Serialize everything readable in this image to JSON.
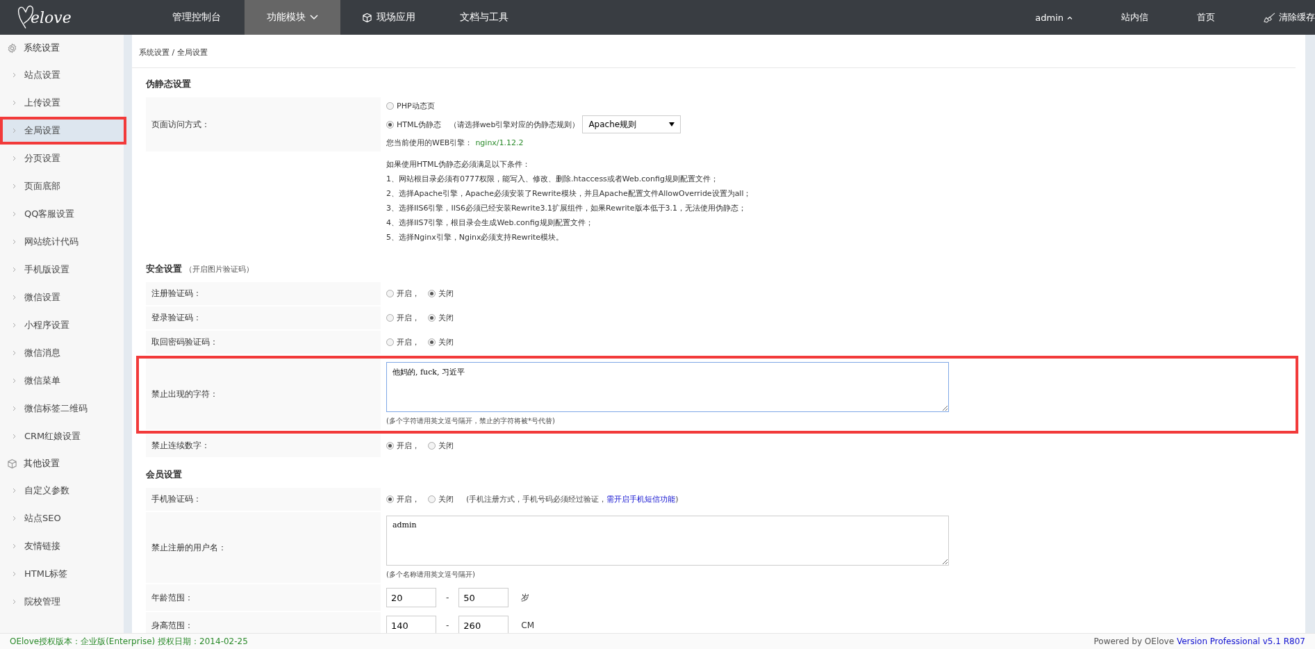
{
  "logo": {
    "text": "elove"
  },
  "nav": [
    {
      "label": "管理控制台",
      "kind": "plain",
      "selected": false
    },
    {
      "label": "功能模块",
      "kind": "dropdown",
      "selected": true
    },
    {
      "label": "现场应用",
      "kind": "cube",
      "selected": false
    },
    {
      "label": "文档与工具",
      "kind": "plain",
      "selected": false
    }
  ],
  "user_menu": [
    {
      "label": "admin",
      "kind": "caret"
    },
    {
      "label": "站内信",
      "kind": "plain"
    },
    {
      "label": "首页",
      "kind": "plain"
    },
    {
      "label": "清除缓存",
      "kind": "brush"
    }
  ],
  "sidebar": [
    {
      "title": "系统设置",
      "kind": "gear",
      "items": [
        {
          "label": "站点设置",
          "selected": false,
          "highlighted": false
        },
        {
          "label": "上传设置",
          "selected": false,
          "highlighted": false
        },
        {
          "label": "全局设置",
          "selected": true,
          "highlighted": true
        },
        {
          "label": "分页设置",
          "selected": false,
          "highlighted": false
        },
        {
          "label": "页面底部",
          "selected": false,
          "highlighted": false
        },
        {
          "label": "QQ客服设置",
          "selected": false,
          "highlighted": false
        },
        {
          "label": "网站统计代码",
          "selected": false,
          "highlighted": false
        },
        {
          "label": "手机版设置",
          "selected": false,
          "highlighted": false
        },
        {
          "label": "微信设置",
          "selected": false,
          "highlighted": false
        },
        {
          "label": "小程序设置",
          "selected": false,
          "highlighted": false
        },
        {
          "label": "微信消息",
          "selected": false,
          "highlighted": false
        },
        {
          "label": "微信菜单",
          "selected": false,
          "highlighted": false
        },
        {
          "label": "微信标签二维码",
          "selected": false,
          "highlighted": false
        },
        {
          "label": "CRM红娘设置",
          "selected": false,
          "highlighted": false
        }
      ]
    },
    {
      "title": "其他设置",
      "kind": "cube",
      "items": [
        {
          "label": "自定义参数",
          "selected": false,
          "highlighted": false
        },
        {
          "label": "站点SEO",
          "selected": false,
          "highlighted": false
        },
        {
          "label": "友情链接",
          "selected": false,
          "highlighted": false
        },
        {
          "label": "HTML标签",
          "selected": false,
          "highlighted": false
        },
        {
          "label": "院校管理",
          "selected": false,
          "highlighted": false
        }
      ]
    }
  ],
  "breadcrumb": "系统设置 / 全局设置",
  "sections": [
    {
      "title": "伪静态设置",
      "rows": [
        {
          "kind": "rewrite",
          "label": "页面访问方式：",
          "options": [
            {
              "label": "PHP动态页",
              "selected": false
            },
            {
              "label": "HTML伪静态",
              "note": "（请选择web引擎对应的伪静态规则）",
              "selected": true
            }
          ],
          "select": "Apache规则",
          "engine_label": "您当前使用的WEB引擎：",
          "engine": "nginx/1.12.2"
        },
        {
          "kind": "notes",
          "lines": [
            "如果使用HTML伪静态必须满足以下条件：",
            "1、网站根目录必须有0777权限，能写入、修改、删除.htaccess或者Web.config规则配置文件；",
            "2、选择Apache引擎，Apache必须安装了Rewrite模块，并且Apache配置文件AllowOverride设置为all；",
            "3、选择IIS6引擎，IIS6必须已经安装Rewrite3.1扩展组件，如果Rewrite版本低于3.1，无法使用伪静态；",
            "4、选择IIS7引擎，根目录会生成Web.config规则配置文件；",
            "5、选择Nginx引擎，Nginx必须支持Rewrite模块。"
          ]
        }
      ]
    },
    {
      "title": "安全设置",
      "subtitle": "（开启图片验证码）",
      "rows": [
        {
          "kind": "radio",
          "label": "注册验证码：",
          "options": [
            {
              "label": "开启，",
              "selected": false
            },
            {
              "label": "关闭",
              "selected": true
            }
          ]
        },
        {
          "kind": "radio",
          "label": "登录验证码：",
          "options": [
            {
              "label": "开启，",
              "selected": false
            },
            {
              "label": "关闭",
              "selected": true
            }
          ]
        },
        {
          "kind": "radio",
          "label": "取回密码验证码：",
          "options": [
            {
              "label": "开启，",
              "selected": false
            },
            {
              "label": "关闭",
              "selected": true
            }
          ]
        },
        {
          "kind": "textarea",
          "label": "禁止出现的字符：",
          "value": "他妈的, fuck, 习近平",
          "hint": "(多个字符请用英文逗号隔开，禁止的字符将被*号代替)",
          "highlighted": true,
          "focused": true
        },
        {
          "kind": "radio",
          "label": "禁止连续数字：",
          "options": [
            {
              "label": "开启，",
              "selected": true
            },
            {
              "label": "关闭",
              "selected": false
            }
          ]
        }
      ]
    },
    {
      "title": "会员设置",
      "rows": [
        {
          "kind": "radio",
          "label": "手机验证码：",
          "options": [
            {
              "label": "开启，",
              "selected": true
            },
            {
              "label": "关闭",
              "selected": false
            }
          ],
          "hint": "(手机注册方式，手机号码必须经过验证，",
          "hint_link": "需开启手机短信功能",
          "hint_end": ")"
        },
        {
          "kind": "textarea",
          "label": "禁止注册的用户名：",
          "value": "admin",
          "hint": "(多个名称请用英文逗号隔开)",
          "highlighted": false,
          "focused": false
        },
        {
          "kind": "range",
          "label": "年龄范围：",
          "from": "20",
          "to": "50",
          "separator": "-",
          "unit": "岁"
        },
        {
          "kind": "range",
          "label": "身高范围：",
          "from": "140",
          "to": "260",
          "separator": "-",
          "unit": "CM"
        }
      ]
    }
  ],
  "footer": {
    "left": "OElove授权版本：企业版(Enterprise) 授权日期：2014-02-25",
    "right": "Powered by OElove",
    "right_link": "Version Professional v5.1 R807"
  }
}
